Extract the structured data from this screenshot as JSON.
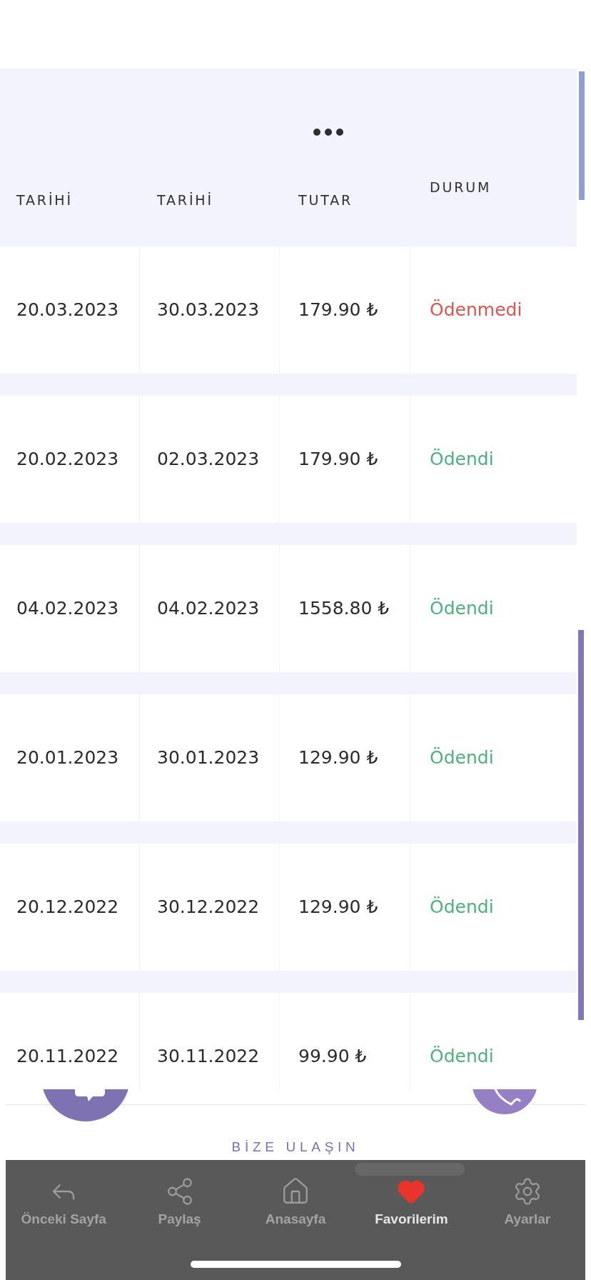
{
  "header": {
    "columns": [
      "TARİHİ",
      "TARİHİ",
      "TUTAR",
      "DURUM"
    ]
  },
  "rows": [
    {
      "cells": [
        "20.03.2023",
        "30.03.2023",
        "179.90 ₺"
      ],
      "status": "Ödenmedi",
      "paid": false
    },
    {
      "cells": [
        "20.02.2023",
        "02.03.2023",
        "179.90 ₺"
      ],
      "status": "Ödendi",
      "paid": true
    },
    {
      "cells": [
        "04.02.2023",
        "04.02.2023",
        "1558.80 ₺"
      ],
      "status": "Ödendi",
      "paid": true
    },
    {
      "cells": [
        "20.01.2023",
        "30.01.2023",
        "129.90 ₺"
      ],
      "status": "Ödendi",
      "paid": true
    },
    {
      "cells": [
        "20.12.2022",
        "30.12.2022",
        "129.90 ₺"
      ],
      "status": "Ödendi",
      "paid": true
    },
    {
      "cells": [
        "20.11.2022",
        "30.11.2022",
        "99.90 ₺"
      ],
      "status": "Ödendi",
      "paid": true
    }
  ],
  "contact": {
    "label": "BİZE ULAŞIN"
  },
  "nav": [
    {
      "label": "Önceki Sayfa",
      "kind": "back",
      "selected": false
    },
    {
      "label": "Paylaş",
      "kind": "share",
      "selected": false
    },
    {
      "label": "Anasayfa",
      "kind": "home",
      "selected": false
    },
    {
      "label": "Favorilerim",
      "kind": "favorites",
      "selected": true
    },
    {
      "label": "Ayarlar",
      "kind": "settings",
      "selected": false
    }
  ]
}
